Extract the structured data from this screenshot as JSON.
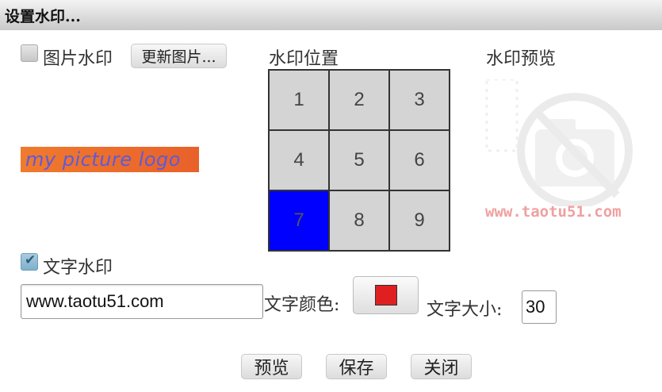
{
  "dialog": {
    "title": "设置水印..."
  },
  "image_watermark": {
    "label": "图片水印",
    "checked": false,
    "update_button_label": "更新图片...",
    "logo_text": "my picture logo"
  },
  "position": {
    "label": "水印位置",
    "cells": [
      "1",
      "2",
      "3",
      "4",
      "5",
      "6",
      "7",
      "8",
      "9"
    ],
    "selected": "7",
    "selected_color": "#0000ff"
  },
  "preview": {
    "label": "水印预览",
    "icon": "no-camera-icon",
    "watermark_text": "www.taotu51.com"
  },
  "text_watermark": {
    "label": "文字水印",
    "checked": true,
    "text_value": "www.taotu51.com",
    "color_label": "文字颜色:",
    "color_value": "#e02020",
    "size_label": "文字大小:",
    "size_value": "30"
  },
  "actions": {
    "preview_label": "预览",
    "save_label": "保存",
    "close_label": "关闭"
  }
}
